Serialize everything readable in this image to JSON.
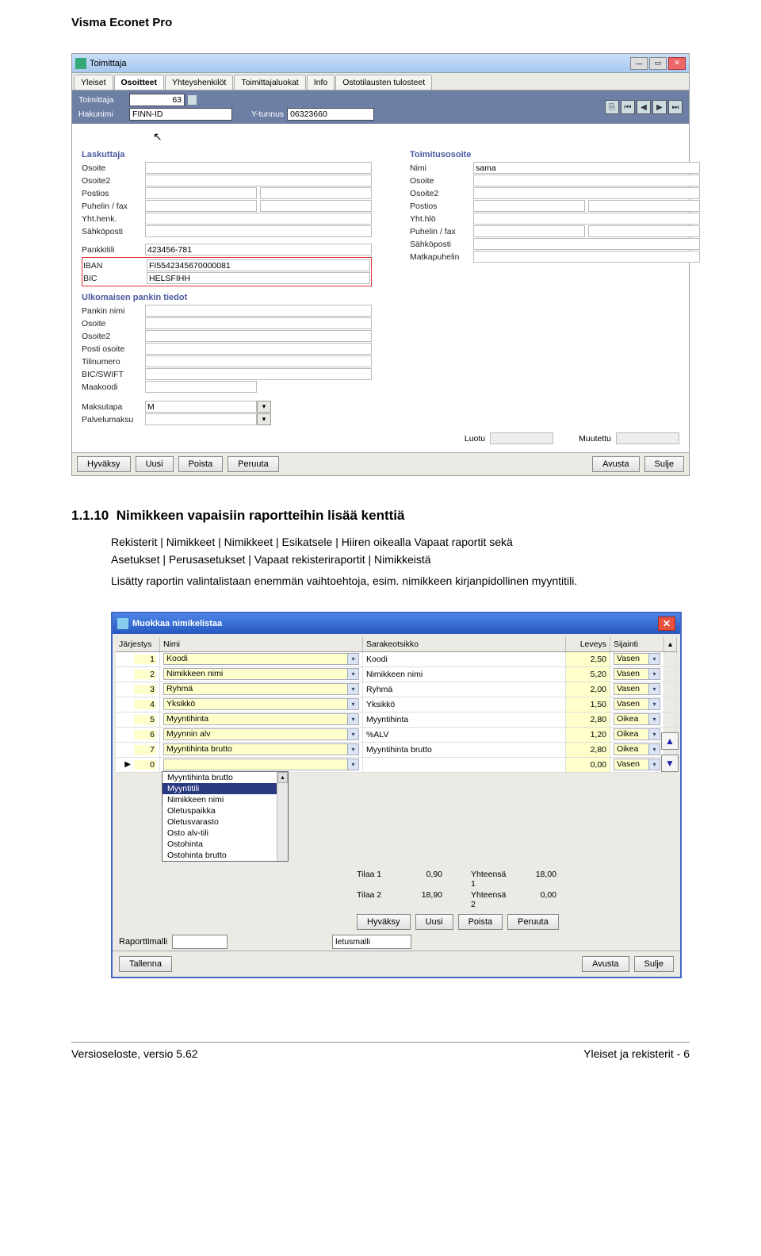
{
  "doc": {
    "header": "Visma Econet Pro",
    "section_num": "1.1.10",
    "section_title": "Nimikkeen vapaisiin raportteihin lisää kenttiä",
    "p1": "Rekisterit | Nimikkeet | Nimikkeet | Esikatsele | Hiiren oikealla Vapaat raportit sekä",
    "p2": "Asetukset | Perusasetukset | Vapaat rekisteriraportit | Nimikkeistä",
    "p3": "Lisätty raportin valintalistaan enemmän vaihtoehtoja, esim. nimikkeen kirjanpidollinen myyntitili.",
    "footer_left": "Versioseloste, versio 5.62",
    "footer_right": "Yleiset ja rekisterit - 6"
  },
  "win1": {
    "title": "Toimittaja",
    "tabs": [
      "Yleiset",
      "Osoitteet",
      "Yhteyshenkilöt",
      "Toimittajaluokat",
      "Info",
      "Ostotilausten tulosteet"
    ],
    "active_tab": 1,
    "toolbar": {
      "lbl_toimittaja": "Toimittaja",
      "lbl_hakunimi": "Hakunimi",
      "lbl_ytunnus": "Y-tunnus",
      "val_toimittaja": "63",
      "val_hakunimi": "FINN-ID",
      "val_ytunnus": "06323660"
    },
    "laskuttaja": {
      "title": "Laskuttaja",
      "fields": [
        "Osoite",
        "Osoite2",
        "Postios",
        "Puhelin / fax",
        "Yht.henk.",
        "Sähköposti"
      ]
    },
    "pankki": {
      "rows": [
        {
          "label": "Pankkitili",
          "value": "423456-781"
        },
        {
          "label": "IBAN",
          "value": "FI5542345670000081"
        },
        {
          "label": "BIC",
          "value": "HELSFIHH"
        }
      ]
    },
    "toimitus": {
      "title": "Toimitusosoite",
      "nimi_val": "sama",
      "fields": [
        "Nimi",
        "Osoite",
        "Osoite2",
        "Postios",
        "Yht.hlö",
        "Puhelin / fax",
        "Sähköposti",
        "Matkapuhelin"
      ]
    },
    "ulkomaisen": {
      "title": "Ulkomaisen pankin tiedot",
      "fields": [
        "Pankin nimi",
        "Osoite",
        "Osoite2",
        "Posti osoite",
        "Tilinumero",
        "BIC/SWIFT",
        "Maakoodi"
      ]
    },
    "maksutapa": {
      "label": "Maksutapa",
      "value": "M"
    },
    "palvelumaksu": {
      "label": "Palvelumaksu"
    },
    "luotu": "Luotu",
    "muutettu": "Muutettu",
    "buttons": {
      "hyvaksy": "Hyväksy",
      "uusi": "Uusi",
      "poista": "Poista",
      "peruuta": "Peruuta",
      "avusta": "Avusta",
      "sulje": "Sulje"
    }
  },
  "win2": {
    "title": "Muokkaa nimikelistaa",
    "headers": {
      "jarjestys": "Järjestys",
      "nimi": "Nimi",
      "sarake": "Sarakeotsikko",
      "leveys": "Leveys",
      "sijainti": "Sijainti"
    },
    "rows": [
      {
        "n": "1",
        "nimi": "Koodi",
        "sar": "Koodi",
        "lev": "2,50",
        "sij": "Vasen"
      },
      {
        "n": "2",
        "nimi": "Nimikkeen nimi",
        "sar": "Nimikkeen nimi",
        "lev": "5,20",
        "sij": "Vasen"
      },
      {
        "n": "3",
        "nimi": "Ryhmä",
        "sar": "Ryhmä",
        "lev": "2,00",
        "sij": "Vasen"
      },
      {
        "n": "4",
        "nimi": "Yksikkö",
        "sar": "Yksikkö",
        "lev": "1,50",
        "sij": "Vasen"
      },
      {
        "n": "5",
        "nimi": "Myyntihinta",
        "sar": "Myyntihinta",
        "lev": "2,80",
        "sij": "Oikea"
      },
      {
        "n": "6",
        "nimi": "Myynnin alv",
        "sar": "%ALV",
        "lev": "1,20",
        "sij": "Oikea"
      },
      {
        "n": "7",
        "nimi": "Myyntihinta brutto",
        "sar": "Myyntihinta brutto",
        "lev": "2,80",
        "sij": "Oikea"
      },
      {
        "n": "0",
        "nimi": "",
        "sar": "",
        "lev": "0,00",
        "sij": "Vasen"
      }
    ],
    "dropdown_options": [
      "Myyntihinta brutto",
      "Myyntitili",
      "Nimikkeen nimi",
      "Oletuspaikka",
      "Oletusvarasto",
      "Osto alv-tili",
      "Ostohinta",
      "Ostohinta brutto"
    ],
    "dropdown_selected": "Myyntitili",
    "tila": {
      "t1": "Tilaa 1",
      "t1v": "0,90",
      "y1": "Yhteensä 1",
      "y1v": "18,00",
      "t2": "Tilaa 2",
      "t2v": "18,90",
      "y2": "Yhteensä 2",
      "y2v": "0,00"
    },
    "midbtns": {
      "hyvaksy": "Hyväksy",
      "uusi": "Uusi",
      "poista": "Poista",
      "peruuta": "Peruuta"
    },
    "rap_label": "Raporttimalli",
    "rap_val": "letusmalli",
    "bottom": {
      "tallenna": "Tallenna",
      "avusta": "Avusta",
      "sulje": "Sulje"
    }
  }
}
